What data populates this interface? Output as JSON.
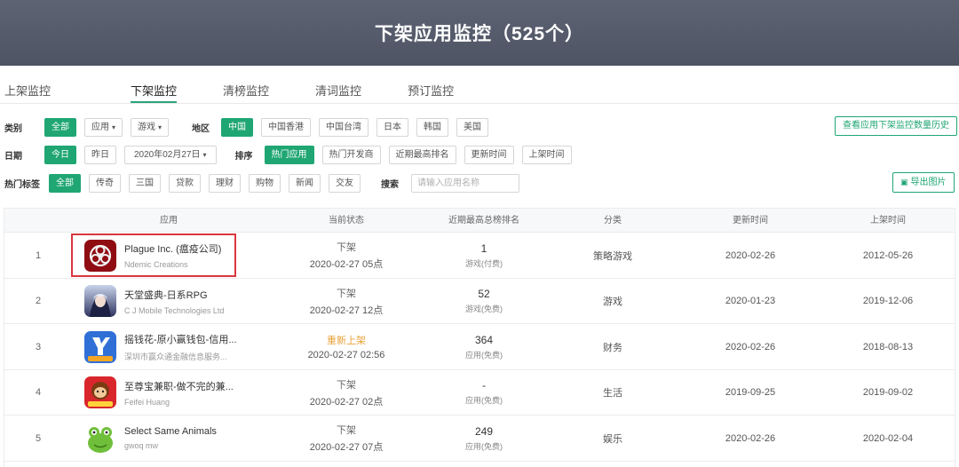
{
  "header": {
    "title": "下架应用监控（525个）"
  },
  "tabs": [
    "上架监控",
    "下架监控",
    "清榜监控",
    "清词监控",
    "预订监控"
  ],
  "filters": {
    "category_label": "类别",
    "category": [
      "全部",
      "应用",
      "游戏"
    ],
    "region_label": "地区",
    "region": [
      "中国",
      "中国香港",
      "中国台湾",
      "日本",
      "韩国",
      "美国"
    ],
    "history_button": "查看应用下架监控数量历史",
    "date_label": "日期",
    "date": [
      "今日",
      "昨日"
    ],
    "date_select": "2020年02月27日",
    "sort_label": "排序",
    "sort": [
      "热门应用",
      "热门开发商",
      "近期最高排名",
      "更新时间",
      "上架时间"
    ],
    "tags_label": "热门标签",
    "tags": [
      "全部",
      "传奇",
      "三国",
      "贷款",
      "理财",
      "购物",
      "新闻",
      "交友"
    ],
    "search_label": "搜索",
    "search_placeholder": "请输入应用名称",
    "export_button": "导出图片"
  },
  "table": {
    "headers": [
      "应用",
      "当前状态",
      "近期最高总榜排名",
      "分类",
      "更新时间",
      "上架时间"
    ],
    "rows": [
      {
        "index": "1",
        "name": "Plague Inc. (瘟疫公司)",
        "developer": "Ndemic Creations",
        "status": "下架",
        "status_time": "2020-02-27 05点",
        "rank": "1",
        "rank_type": "游戏(付费)",
        "category": "策略游戏",
        "updated": "2020-02-26",
        "listed": "2012-05-26",
        "icon": "plague-biohazard-icon",
        "color": "#c0141c"
      },
      {
        "index": "2",
        "name": "天堂盛典-日系RPG",
        "developer": "C J Mobile Technologies Ltd",
        "status": "下架",
        "status_time": "2020-02-27 12点",
        "rank": "52",
        "rank_type": "游戏(免费)",
        "category": "游戏",
        "updated": "2020-01-23",
        "listed": "2019-12-06",
        "icon": "anime-character-icon",
        "color": "#3a3f6b"
      },
      {
        "index": "3",
        "name": "摇钱花-原小赢钱包-信用...",
        "developer": "深圳市赢众通金融信息服务...",
        "status": "重新上架",
        "status_time": "2020-02-27 02:56",
        "rank": "364",
        "rank_type": "应用(免费)",
        "category": "财务",
        "updated": "2020-02-26",
        "listed": "2018-08-13",
        "icon": "wallet-y-icon",
        "color": "#2f6fd6"
      },
      {
        "index": "4",
        "name": "至尊宝兼职-做不完的兼...",
        "developer": "Feifei Huang",
        "status": "下架",
        "status_time": "2020-02-27 02点",
        "rank": "-",
        "rank_type": "应用(免费)",
        "category": "生活",
        "updated": "2019-09-25",
        "listed": "2019-09-02",
        "icon": "monkey-king-icon",
        "color": "#d9262c"
      },
      {
        "index": "5",
        "name": "Select Same Animals",
        "developer": "gwoq mw",
        "status": "下架",
        "status_time": "2020-02-27 07点",
        "rank": "249",
        "rank_type": "应用(免费)",
        "category": "娱乐",
        "updated": "2020-02-26",
        "listed": "2020-02-04",
        "icon": "green-frog-icon",
        "color": "#6fbf3a"
      }
    ]
  },
  "colors": {
    "accent": "#1fa673",
    "highlight": "#d9363e",
    "relisted": "#e8a23a",
    "header_bg": "#555b6b"
  }
}
